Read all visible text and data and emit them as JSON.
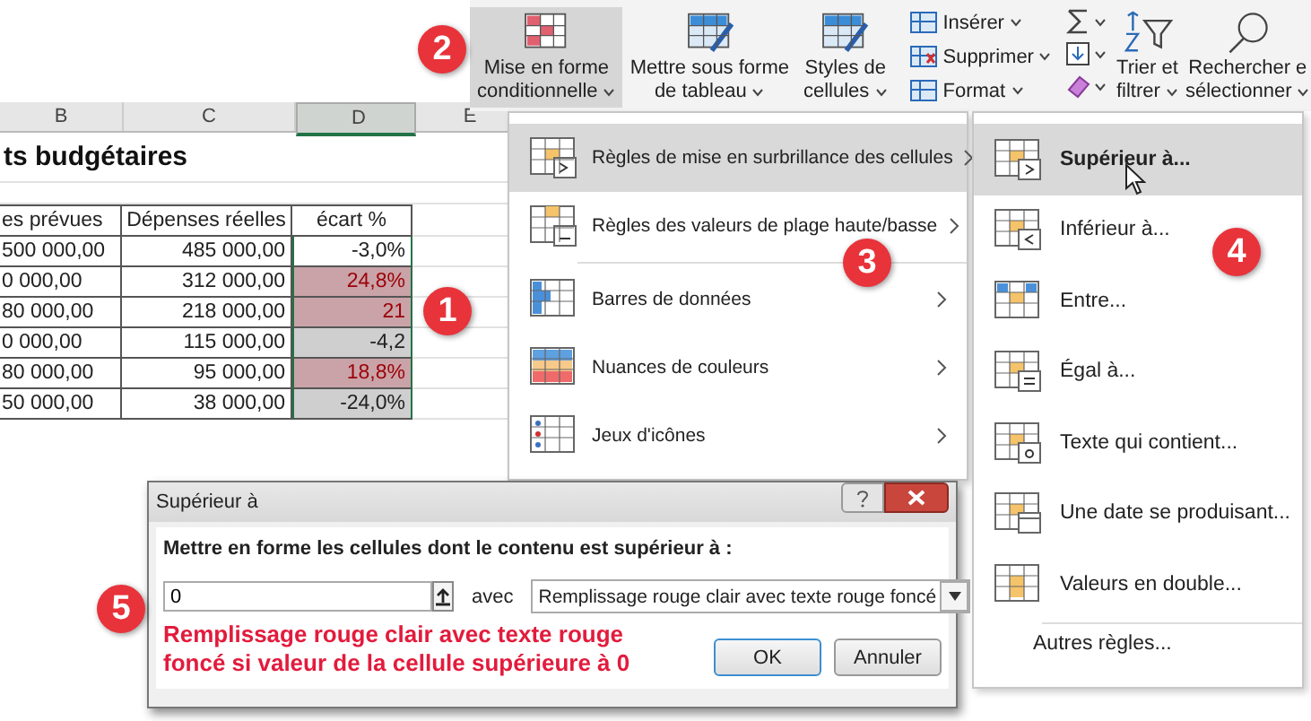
{
  "sheet": {
    "columns": [
      "B",
      "C",
      "D",
      "E"
    ],
    "title": "ts budgétaires",
    "headers": [
      "es prévues",
      "Dépenses réelles",
      "écart %"
    ],
    "rows": [
      {
        "b": "500 000,00",
        "c": "485 000,00",
        "d": "-3,0%",
        "highlighted": false,
        "active": true
      },
      {
        "b": "0 000,00",
        "c": "312 000,00",
        "d": "24,8%",
        "highlighted": true,
        "active": false
      },
      {
        "b": "80 000,00",
        "c": "218 000,00",
        "d": "21",
        "highlighted": true,
        "active": false
      },
      {
        "b": "0 000,00",
        "c": "115 000,00",
        "d": "-4,2",
        "highlighted": false,
        "active": false
      },
      {
        "b": "80 000,00",
        "c": "95 000,00",
        "d": "18,8%",
        "highlighted": true,
        "active": false
      },
      {
        "b": "50 000,00",
        "c": "38 000,00",
        "d": "-24,0%",
        "highlighted": false,
        "active": false
      }
    ]
  },
  "ribbon": {
    "big_buttons": [
      {
        "lines": [
          "Mise en forme",
          "conditionnelle"
        ],
        "selected": true
      },
      {
        "lines": [
          "Mettre sous forme",
          "de tableau"
        ],
        "selected": false
      },
      {
        "lines": [
          "Styles de",
          "cellules"
        ],
        "selected": false
      }
    ],
    "cells_group": [
      "Insérer",
      "Supprimer",
      "Format"
    ],
    "editing": [
      {
        "lines": [
          "Trier et",
          "filtrer"
        ]
      },
      {
        "lines": [
          "Rechercher e",
          "sélectionner"
        ]
      }
    ]
  },
  "menu": {
    "items": [
      {
        "label": "Règles de mise en surbrillance des cellules",
        "selected": true
      },
      {
        "label": "Règles des valeurs de plage haute/basse",
        "selected": false
      },
      {
        "label": "Barres de données",
        "selected": false
      },
      {
        "label": "Nuances de couleurs",
        "selected": false
      },
      {
        "label": "Jeux d'icônes",
        "selected": false
      }
    ]
  },
  "submenu": {
    "items": [
      {
        "label": "Supérieur à...",
        "selected": true
      },
      {
        "label": "Inférieur à...",
        "selected": false
      },
      {
        "label": "Entre...",
        "selected": false
      },
      {
        "label": "Égal à...",
        "selected": false
      },
      {
        "label": "Texte qui contient...",
        "selected": false
      },
      {
        "label": "Une date se produisant...",
        "selected": false
      },
      {
        "label": "Valeurs en double...",
        "selected": false
      }
    ],
    "footer": "Autres règles..."
  },
  "dialog": {
    "title": "Supérieur à",
    "prompt": "Mettre en forme les cellules dont le contenu est supérieur à :",
    "value": "0",
    "with_label": "avec",
    "format": "Remplissage rouge clair avec texte rouge foncé",
    "buttons": [
      "OK",
      "Annuler"
    ]
  },
  "annotation": "Remplissage rouge clair avec texte rouge foncé si valeur de la cellule supérieure à 0",
  "badges": [
    "1",
    "2",
    "3",
    "4",
    "5"
  ]
}
